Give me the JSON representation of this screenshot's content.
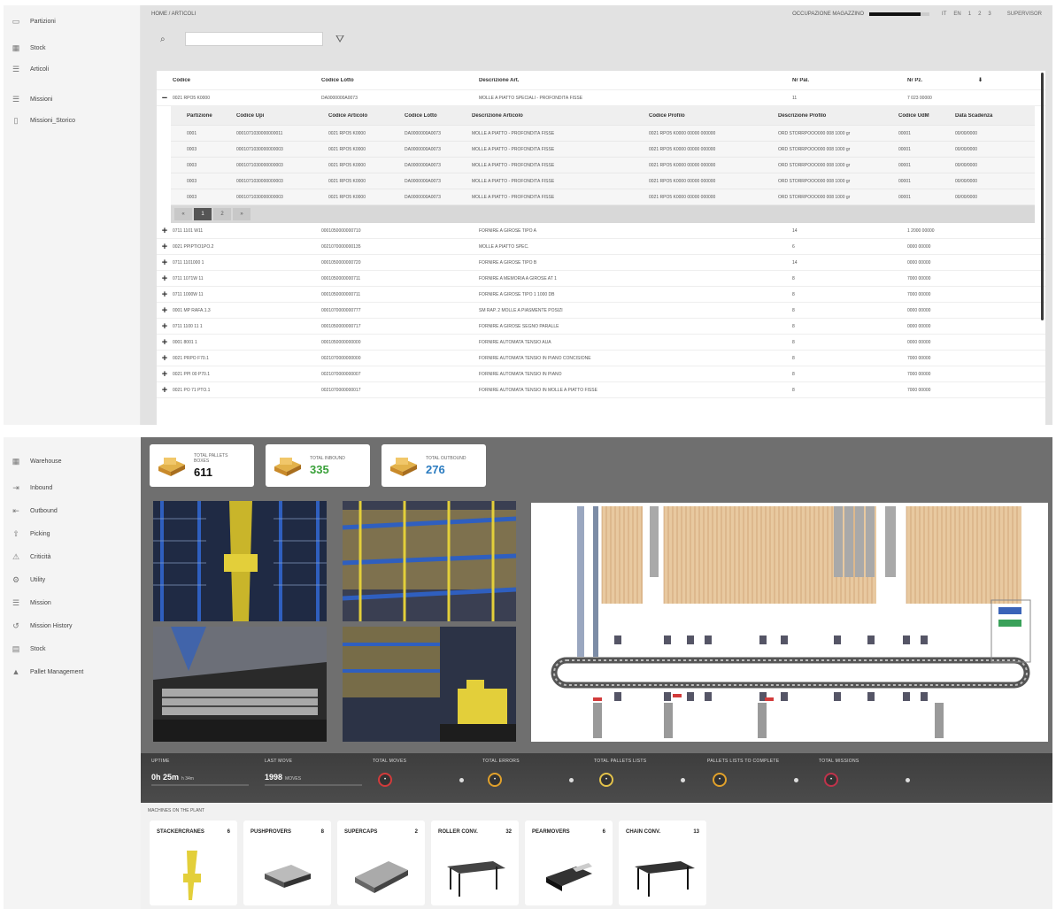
{
  "top": {
    "sidebar": {
      "items": [
        {
          "label": "Partizioni",
          "icon": "folder-icon"
        },
        {
          "label": "Stock",
          "icon": "grid-icon"
        },
        {
          "label": "Articoli",
          "icon": "list-icon"
        },
        {
          "label": "Missioni",
          "icon": "list-icon"
        },
        {
          "label": "Missioni_Storico",
          "icon": "history-icon"
        }
      ]
    },
    "topbar": {
      "breadcrumb": "HOME / ARTICOLI",
      "status_label": "OCCUPAZIONE MAGAZZINO",
      "status_fill": 0.85,
      "chips": [
        "IT",
        "EN",
        "1",
        "2",
        "3"
      ],
      "user": "SUPERVISOR"
    },
    "search": {
      "placeholder": ""
    },
    "grid": {
      "columns": [
        "Codice",
        "Codice Lotto",
        "Descrizione Art.",
        "Nr Pal.",
        "Nr Pz."
      ],
      "expanded_row": [
        "0021 RPO5 K0000",
        "DA0000000A0073",
        "MOLLE A PIATTO SPECIALI - PROFONDITÀ FISSE",
        "11",
        "7 023 00000"
      ],
      "subtable": {
        "columns": [
          "Partizione",
          "Codice Upi",
          "Codice Articolo",
          "Codice Lotto",
          "Descrizione Articolo",
          "Codice Profilo",
          "Descrizione Profilo",
          "Codice UdM",
          "Data Scadenza"
        ],
        "rows": [
          [
            "0001",
            "0001071030000000011",
            "0021 RPO5 K0000",
            "DA0000000A0073",
            "MOLLE A PIATTO - PROFONDITÀ FISSE",
            "0021 RPO5 K0000 00000 000000",
            "ORD STORRPOOO000 008 1000 gr",
            "00001",
            "00/00/0000"
          ],
          [
            "0003",
            "0001071030000000003",
            "0021 RPO5 K0000",
            "DA0000000A0073",
            "MOLLE A PIATTO - PROFONDITÀ FISSE",
            "0021 RPO5 K0000 00000 000000",
            "ORD STORRPOOO000 008 1000 gr",
            "00001",
            "00/00/0000"
          ],
          [
            "0003",
            "0001071030000000003",
            "0021 RPO5 K0000",
            "DA0000000A0073",
            "MOLLE A PIATTO - PROFONDITÀ FISSE",
            "0021 RPO5 K0000 00000 000000",
            "ORD STORRPOOO000 008 1000 gr",
            "00001",
            "00/00/0000"
          ],
          [
            "0003",
            "0001071030000000003",
            "0021 RPO5 K0000",
            "DA0000000A0073",
            "MOLLE A PIATTO - PROFONDITÀ FISSE",
            "0021 RPO5 K0000 00000 000000",
            "ORD STORRPOOO000 008 1000 gr",
            "00001",
            "00/00/0000"
          ],
          [
            "0003",
            "0001071030000000003",
            "0021 RPO5 K0000",
            "DA0000000A0073",
            "MOLLE A PIATTO - PROFONDITÀ FISSE",
            "0021 RPO5 K0000 00000 000000",
            "ORD STORRPOOO000 008 1000 gr",
            "00001",
            "00/00/0000"
          ]
        ],
        "pages": [
          "«",
          "1",
          "2",
          "»"
        ]
      },
      "rows": [
        [
          "0711 1101 W11",
          "0001050000000710",
          "FORNIRE A GIROSE TIPO A",
          "14",
          "1 2000 00000"
        ],
        [
          "0021 PPIPTIO1PO.2",
          "0021070000000135",
          "MOLLE A PIATTO SPEC.",
          "6",
          "0000 00000"
        ],
        [
          "0711 1101000 1",
          "0001050000000720",
          "FORNIRE A GIROSE TIPO B",
          "14",
          "0000 00000"
        ],
        [
          "0711 1071W 11",
          "0001050000000711",
          "FORNIRE A MEMORIA A GIROSE AT 1",
          "8",
          "7000 00000"
        ],
        [
          "0711 1000W 11",
          "0001050000000711",
          "FORNIRE A GIROSE TIPO 1 1000 DB",
          "8",
          "7000 00000"
        ],
        [
          "0001 MP RAFA.1.3",
          "0001070000000777",
          "SM RAP. 2 MOLLE A PIASMENTE POSIZI",
          "8",
          "0000 00000"
        ],
        [
          "0711 1100 11 1",
          "0001050000000717",
          "FORNIRE A GIROSE SEGNO PARALLE",
          "8",
          "0000 00000"
        ],
        [
          "0001 8001 1",
          "0001050000000000",
          "FORNIRE AUTOMATA TENSIO AUA",
          "8",
          "0000 00000"
        ],
        [
          "0021 PRPO F70.1",
          "0021070000000000",
          "FORNIRE AUTOMATA TENSIO IN PIANO CONCISIONE",
          "8",
          "7000 00000"
        ],
        [
          "0021 PPI 00 P70.1",
          "0021070000000007",
          "FORNIRE AUTOMATA TENSIO IN PIANO",
          "8",
          "7000 00000"
        ],
        [
          "0021 PO 71 PTO.1",
          "0021070000000017",
          "FORNIRE AUTOMATA TENSIO IN MOLLE A PIATTO FISSE",
          "8",
          "7000 00000"
        ]
      ]
    }
  },
  "bottom": {
    "sidebar": {
      "items": [
        {
          "label": "Warehouse",
          "icon": "grid-icon"
        },
        {
          "label": "Inbound",
          "icon": "inbound-icon"
        },
        {
          "label": "Outbound",
          "icon": "outbound-icon"
        },
        {
          "label": "Picking",
          "icon": "picking-icon"
        },
        {
          "label": "Criticità",
          "icon": "alert-icon"
        },
        {
          "label": "Utility",
          "icon": "utility-icon"
        },
        {
          "label": "Mission",
          "icon": "list-icon"
        },
        {
          "label": "Mission History",
          "icon": "history-icon"
        },
        {
          "label": "Stock",
          "icon": "stock-icon"
        },
        {
          "label": "Pallet Management",
          "icon": "pallet-icon"
        }
      ]
    },
    "kpis": [
      {
        "label": "TOTAL PALLETS BOXES",
        "value": "611",
        "color": "#111111"
      },
      {
        "label": "TOTAL INBOUND",
        "value": "335",
        "color": "#3aa13a"
      },
      {
        "label": "TOTAL OUTBOUND",
        "value": "276",
        "color": "#2a7bc0"
      }
    ],
    "stats": [
      {
        "label": "UPTIME",
        "value": "0h 25m",
        "unit": "h 34m"
      },
      {
        "label": "LAST MOVE",
        "value": "1998",
        "unit": "MOVES"
      },
      {
        "label": "TOTAL MOVES",
        "ring_color": "#d23b3b"
      },
      {
        "label": "TOTAL ERRORS",
        "ring_color": "#e1a12b"
      },
      {
        "label": "TOTAL PALLETS LISTS",
        "ring_color": "#e3c24a"
      },
      {
        "label": "PALLETS LISTS TO COMPLETE",
        "ring_color": "#e1a12b"
      },
      {
        "label": "TOTAL MISSIONS",
        "ring_color": "#c0334b"
      }
    ],
    "machines_title": "MACHINES ON THE PLANT",
    "machines": [
      {
        "name": "STACKERCRANES",
        "count": "6",
        "icon": "stacker-crane-icon"
      },
      {
        "name": "PUSHPROVERS",
        "count": "8",
        "icon": "pushprover-icon"
      },
      {
        "name": "SUPERCAPS",
        "count": "2",
        "icon": "supercap-icon"
      },
      {
        "name": "ROLLER CONV.",
        "count": "32",
        "icon": "roller-conveyor-icon"
      },
      {
        "name": "PEARMOVERS",
        "count": "6",
        "icon": "pearmover-icon"
      },
      {
        "name": "CHAIN CONV.",
        "count": "13",
        "icon": "chain-conveyor-icon"
      }
    ]
  }
}
